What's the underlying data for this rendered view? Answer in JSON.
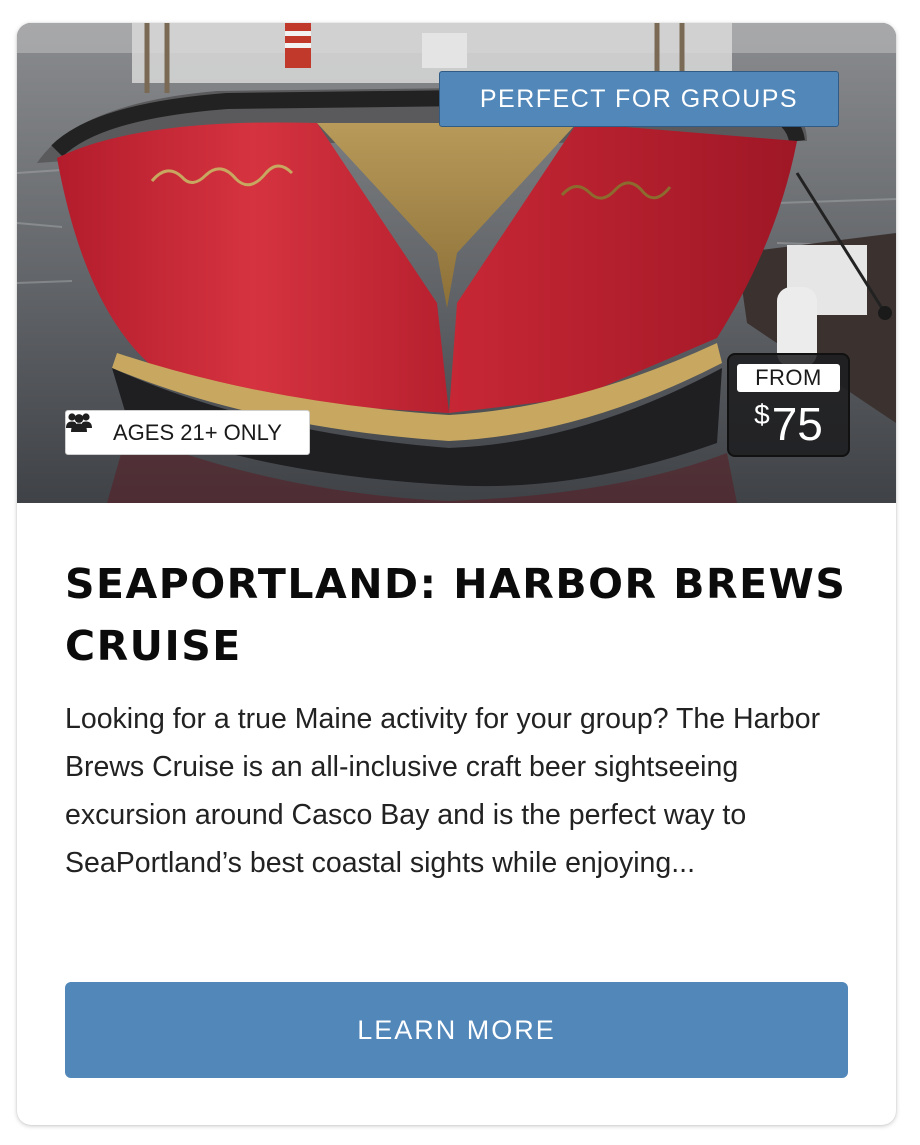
{
  "card": {
    "badges": {
      "group_label": "PERFECT FOR GROUPS",
      "age_label": "AGES 21+ ONLY",
      "age_icon": "users-icon"
    },
    "price": {
      "from_label": "FROM",
      "currency": "$",
      "amount": "75"
    },
    "title": "SEAPORTLAND: HARBOR BREWS CRUISE",
    "description": "Looking for a true Maine activity for your group? The Harbor Brews Cruise is an all-inclusive craft beer sightseeing excursion around Casco Bay and is the perfect way to SeaPortland’s best coastal sights while enjoying...",
    "cta_label": "LEARN MORE",
    "colors": {
      "accent": "#5287b9",
      "boat_hull": "#c42a38",
      "boat_trim": "#a8874a"
    }
  }
}
